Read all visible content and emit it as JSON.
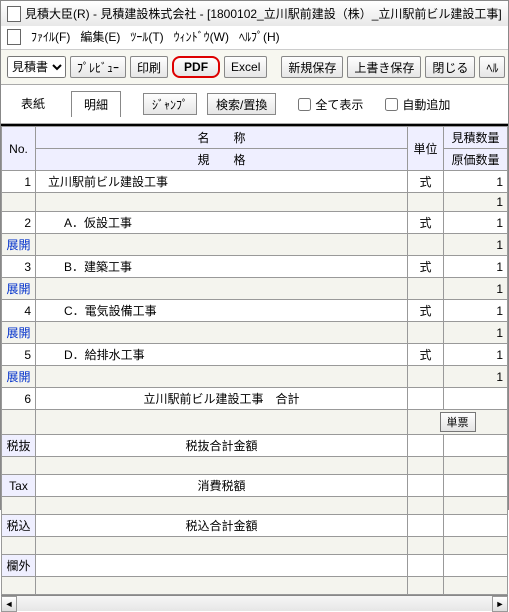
{
  "window": {
    "title": "見積大臣(R) - 見積建設株式会社 - [1800102_立川駅前建設（株）_立川駅前ビル建設工事]"
  },
  "menu": {
    "file": "ﾌｧｲﾙ(F)",
    "edit": "編集(E)",
    "tool": "ﾂｰﾙ(T)",
    "window": "ｳｨﾝﾄﾞｳ(W)",
    "help": "ﾍﾙﾌﾟ(H)"
  },
  "toolbar": {
    "doc_type": "見積書",
    "preview": "ﾌﾟﾚﾋﾞｭｰ",
    "print": "印刷",
    "pdf": "PDF",
    "excel": "Excel",
    "save_new": "新規保存",
    "save_over": "上書き保存",
    "close": "閉じる",
    "help": "ﾍﾙ"
  },
  "subbar": {
    "tab_cover": "表紙",
    "tab_detail": "明細",
    "jump": "ｼﾞｬﾝﾌﾟ",
    "find": "検索/置換",
    "show_all": "全て表示",
    "auto_add": "自動追加"
  },
  "headers": {
    "no": "No.",
    "name": "名　　称",
    "spec": "規　　格",
    "unit": "単位",
    "qty_est": "見積数量",
    "qty_cost": "原価数量"
  },
  "rows": [
    {
      "no": "1",
      "name": "立川駅前ビル建設工事",
      "unit": "式",
      "qty": "1"
    },
    {
      "no": "2",
      "expand": "展開",
      "name": "A．仮設工事",
      "unit": "式",
      "qty": "1"
    },
    {
      "no": "3",
      "expand": "展開",
      "name": "B．建築工事",
      "unit": "式",
      "qty": "1"
    },
    {
      "no": "4",
      "expand": "展開",
      "name": "C．電気設備工事",
      "unit": "式",
      "qty": "1"
    },
    {
      "no": "5",
      "expand": "展開",
      "name": "D．給排水工事",
      "unit": "式",
      "qty": "1"
    },
    {
      "no": "6",
      "name": "立川駅前ビル建設工事　合計",
      "single_btn": "単票"
    }
  ],
  "totals": {
    "zeinuki_lbl": "税抜",
    "zeinuki_txt": "税抜合計金額",
    "tax_lbl": "Tax",
    "tax_txt": "消費税額",
    "zeikomi_lbl": "税込",
    "zeikomi_txt": "税込合計金額",
    "rangai_lbl": "欄外"
  }
}
